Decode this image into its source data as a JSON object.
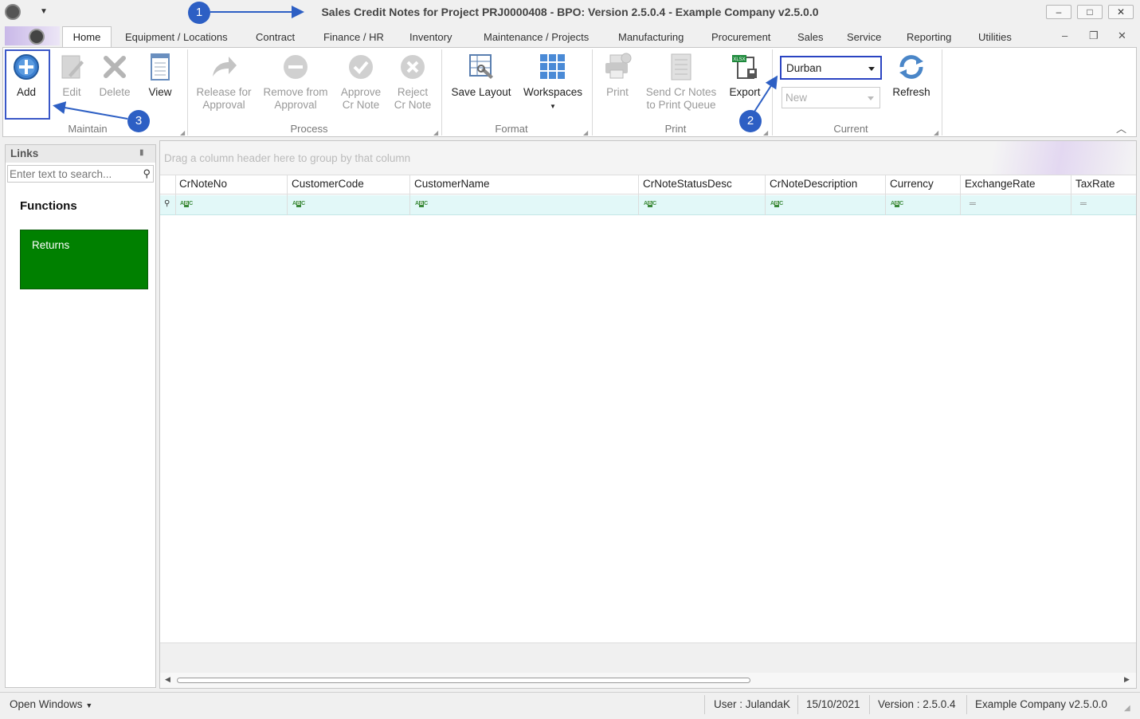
{
  "window": {
    "title": "Sales Credit Notes for Project PRJ0000408 - BPO: Version 2.5.0.4 - Example Company v2.5.0.0",
    "minimize": "–",
    "maximize": "□",
    "close": "✕"
  },
  "tabs": [
    "Home",
    "Equipment / Locations",
    "Contract",
    "Finance / HR",
    "Inventory",
    "Maintenance / Projects",
    "Manufacturing",
    "Procurement",
    "Sales",
    "Service",
    "Reporting",
    "Utilities"
  ],
  "ribbon": {
    "maintain": {
      "label": "Maintain",
      "add": "Add",
      "edit": "Edit",
      "delete": "Delete",
      "view": "View"
    },
    "process": {
      "label": "Process",
      "release_1": "Release for",
      "release_2": "Approval",
      "remove_1": "Remove from",
      "remove_2": "Approval",
      "approve_1": "Approve",
      "approve_2": "Cr Note",
      "reject_1": "Reject",
      "reject_2": "Cr Note"
    },
    "format": {
      "label": "Format",
      "save_layout": "Save Layout",
      "workspaces": "Workspaces"
    },
    "print": {
      "label": "Print",
      "print": "Print",
      "send_1": "Send Cr Notes",
      "send_2": "to Print Queue",
      "export": "Export"
    },
    "current": {
      "label": "Current",
      "site_value": "Durban",
      "status_value": "New",
      "refresh": "Refresh"
    }
  },
  "links": {
    "title": "Links",
    "search_placeholder": "Enter text to search...",
    "functions_label": "Functions",
    "tiles": [
      "Returns"
    ]
  },
  "grid": {
    "group_hint": "Drag a column header here to group by that column",
    "columns": [
      "CrNoteNo",
      "CustomerCode",
      "CustomerName",
      "CrNoteStatusDesc",
      "CrNoteDescription",
      "Currency",
      "ExchangeRate",
      "TaxRate"
    ]
  },
  "status": {
    "open_windows": "Open Windows",
    "user": "User : JulandaK",
    "date": "15/10/2021",
    "version": "Version : 2.5.0.4",
    "company": "Example Company v2.5.0.0"
  },
  "annotations": [
    "1",
    "2",
    "3"
  ],
  "colors": {
    "highlight": "#2a44c2",
    "badge": "#2d5fc4",
    "returns_tile": "#008000",
    "filter_row": "#e2f8f8"
  }
}
